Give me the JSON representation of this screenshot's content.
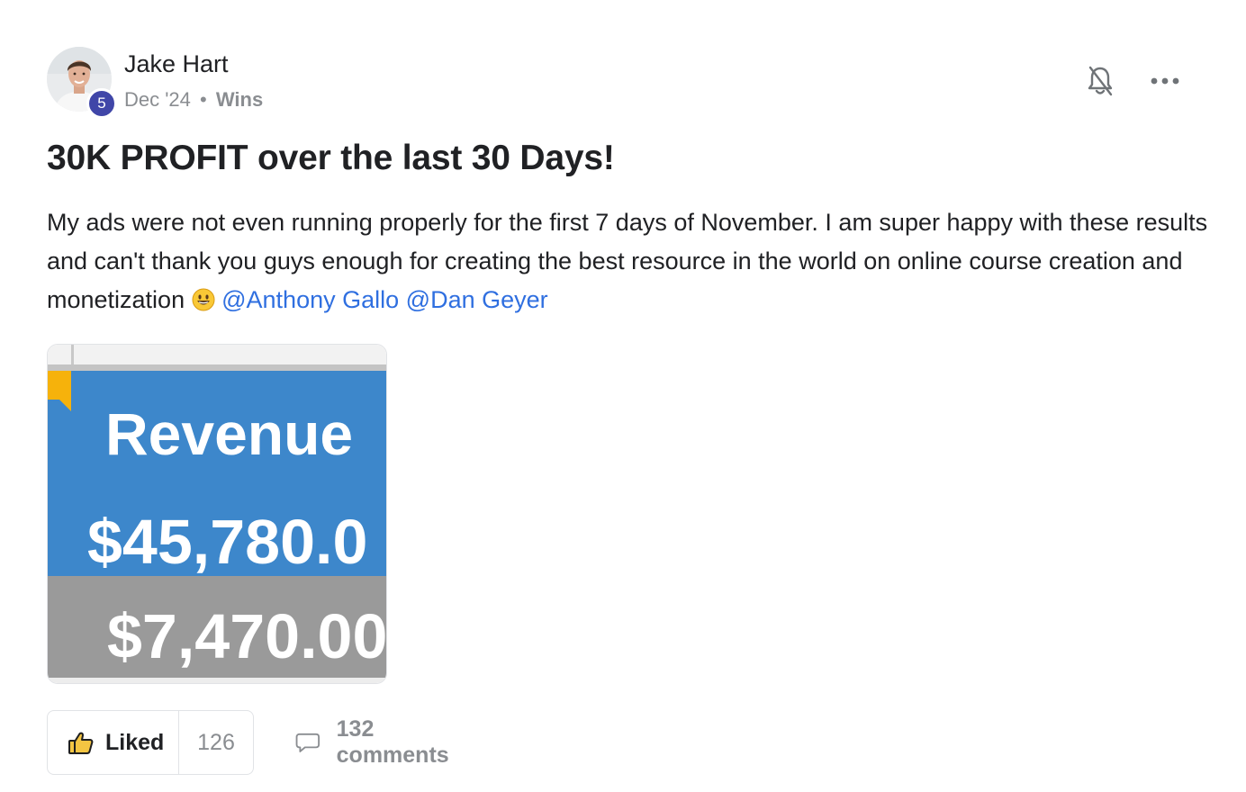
{
  "post": {
    "author": {
      "name": "Jake Hart",
      "level": "5"
    },
    "meta": {
      "date": "Dec '24",
      "separator": "•",
      "category": "Wins"
    },
    "title": "30K PROFIT over the last 30 Days!",
    "body": {
      "text": "My ads were not even running properly for the first 7 days of November. I am super happy with these results and can't thank you guys enough for creating the best resource in the world on online course creation and monetization",
      "emoji": "grinning-face-emoji",
      "mentions": [
        "@Anthony Gallo",
        "@Dan Geyer"
      ]
    },
    "attachment": {
      "label": "Revenue",
      "revenue_value": "$45,780.0",
      "second_value": "$7,470.00",
      "colors": {
        "blue": "#3d87cb",
        "gray": "#9a9a9a",
        "accent": "#f6b20b"
      }
    },
    "actions": {
      "like_label": "Liked",
      "like_count": "126",
      "comments_label": "132 comments"
    },
    "icons": {
      "notify": "bell-off-icon",
      "more": "more-horizontal-icon",
      "like": "thumbs-up-icon",
      "comment": "comment-bubble-icon"
    }
  }
}
